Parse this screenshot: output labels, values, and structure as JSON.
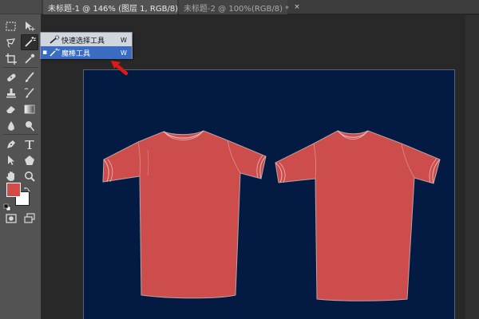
{
  "tabs": [
    {
      "label": "未标题-1 @ 146% (图层 1, RGB/8) *",
      "close": "×",
      "active": true
    },
    {
      "label": "未标题-2 @ 100%(RGB/8) *",
      "close": "×",
      "active": false
    }
  ],
  "flyout": {
    "items": [
      {
        "label": "快速选择工具",
        "shortcut": "W",
        "icon": "quick-selection-icon",
        "selected": false
      },
      {
        "label": "魔棒工具",
        "shortcut": "W",
        "icon": "magic-wand-icon",
        "selected": true,
        "marker": "▪"
      }
    ]
  },
  "toolbar": {
    "tools": [
      "marquee-icon",
      "move-icon",
      "lasso-icon",
      "magic-wand-icon",
      "crop-icon",
      "eyedropper-icon",
      "spot-healing-icon",
      "brush-icon",
      "clone-stamp-icon",
      "history-brush-icon",
      "eraser-icon",
      "gradient-icon",
      "blur-icon",
      "dodge-icon",
      "pen-icon",
      "type-icon",
      "path-selection-icon",
      "shape-icon",
      "hand-icon",
      "zoom-icon",
      "quick-mask-icon",
      "screen-mode-icon"
    ],
    "foreground_color": "#d24a4a",
    "background_color": "#ffffff"
  },
  "document": {
    "background_color": "#031b42",
    "shirt_color": "#cd4c4c",
    "content": [
      "red-tshirt-left",
      "red-tshirt-right"
    ]
  },
  "annotation": {
    "arrow_color": "#e01818"
  }
}
